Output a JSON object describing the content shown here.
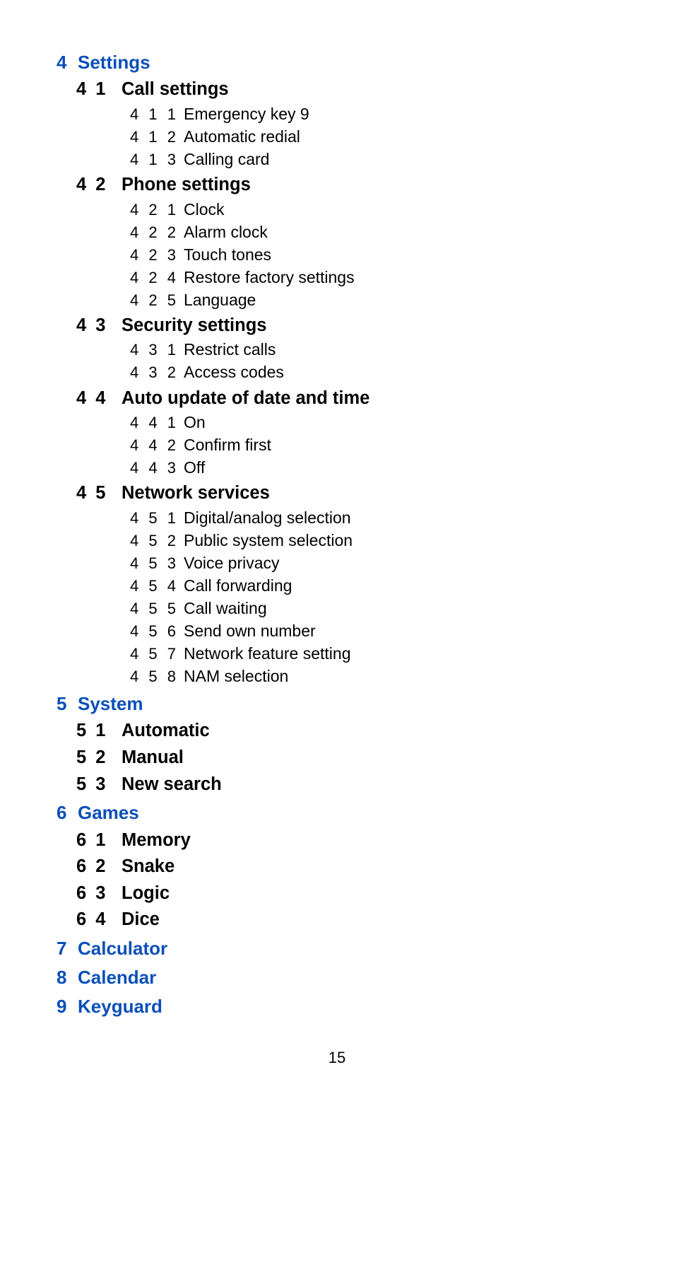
{
  "page_number": "15",
  "sections": [
    {
      "num": "4",
      "label": "Settings",
      "subs": [
        {
          "num": "4 1",
          "label": "Call settings",
          "items": [
            {
              "num": "4 1 1",
              "label": "Emergency key 9"
            },
            {
              "num": "4 1 2",
              "label": "Automatic redial"
            },
            {
              "num": "4 1 3",
              "label": "Calling card"
            }
          ]
        },
        {
          "num": "4 2",
          "label": "Phone settings",
          "items": [
            {
              "num": "4 2 1",
              "label": "Clock"
            },
            {
              "num": "4 2 2",
              "label": "Alarm clock"
            },
            {
              "num": "4 2 3",
              "label": "Touch tones"
            },
            {
              "num": "4 2 4",
              "label": "Restore factory settings"
            },
            {
              "num": "4 2 5",
              "label": "Language"
            }
          ]
        },
        {
          "num": "4 3",
          "label": "Security settings",
          "items": [
            {
              "num": "4 3 1",
              "label": "Restrict calls"
            },
            {
              "num": "4 3 2",
              "label": "Access codes"
            }
          ]
        },
        {
          "num": "4 4",
          "label": "Auto update of date and time",
          "items": [
            {
              "num": "4 4 1",
              "label": "On"
            },
            {
              "num": "4 4 2",
              "label": "Confirm first"
            },
            {
              "num": "4 4 3",
              "label": "Off"
            }
          ]
        },
        {
          "num": "4 5",
          "label": "Network services",
          "items": [
            {
              "num": "4 5 1",
              "label": "Digital/analog selection"
            },
            {
              "num": "4 5 2",
              "label": "Public system selection"
            },
            {
              "num": "4 5 3",
              "label": "Voice privacy"
            },
            {
              "num": "4 5 4",
              "label": "Call forwarding"
            },
            {
              "num": "4 5 5",
              "label": "Call waiting"
            },
            {
              "num": "4 5 6",
              "label": "Send own number"
            },
            {
              "num": "4 5 7",
              "label": "Network feature setting"
            },
            {
              "num": "4 5 8",
              "label": "NAM selection"
            }
          ]
        }
      ]
    },
    {
      "num": "5",
      "label": "System",
      "subs": [
        {
          "num": "5 1",
          "label": "Automatic",
          "items": []
        },
        {
          "num": "5 2",
          "label": "Manual",
          "items": []
        },
        {
          "num": "5 3",
          "label": "New search",
          "items": []
        }
      ]
    },
    {
      "num": "6",
      "label": "Games",
      "subs": [
        {
          "num": "6 1",
          "label": "Memory",
          "items": []
        },
        {
          "num": "6 2",
          "label": "Snake",
          "items": []
        },
        {
          "num": "6 3",
          "label": "Logic",
          "items": []
        },
        {
          "num": "6 4",
          "label": "Dice",
          "items": []
        }
      ]
    },
    {
      "num": "7",
      "label": "Calculator",
      "subs": []
    },
    {
      "num": "8",
      "label": "Calendar",
      "subs": []
    },
    {
      "num": "9",
      "label": "Keyguard",
      "subs": []
    }
  ]
}
